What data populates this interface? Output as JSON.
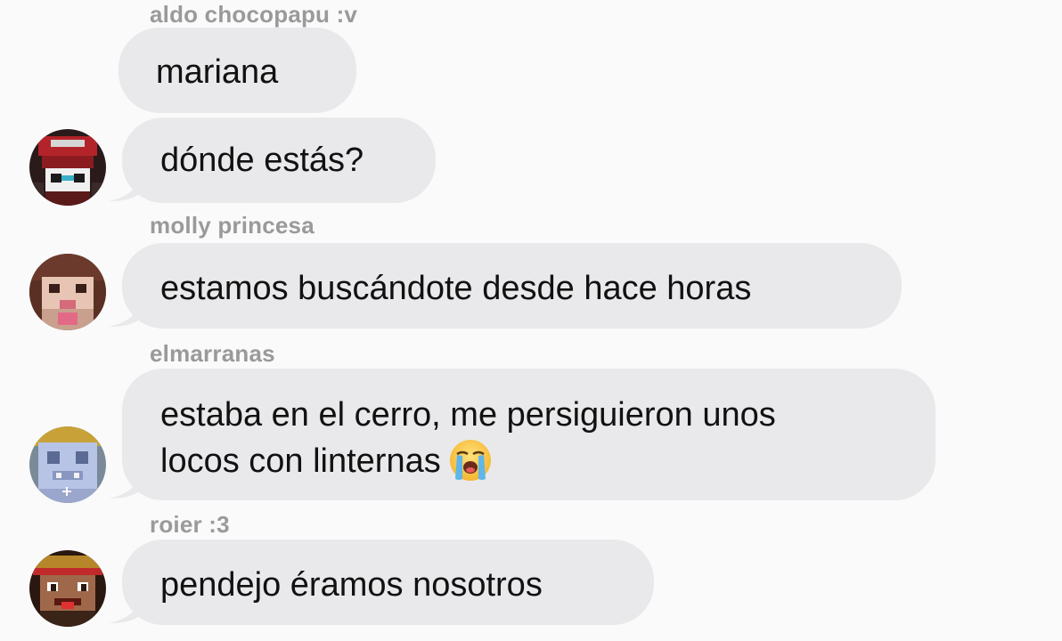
{
  "messages": [
    {
      "sender": "aldo chocopapu :v",
      "text": "mariana"
    },
    {
      "text": "dónde estás?"
    },
    {
      "sender": "molly princesa",
      "text": "estamos buscándote desde hace horas"
    },
    {
      "sender": "elmarranas",
      "line1": "estaba en el cerro, me persiguieron unos",
      "line2": "locos con linternas"
    },
    {
      "sender": "roier :3",
      "text": "pendejo éramos nosotros"
    }
  ],
  "icons": {
    "crying_emoji": "loudly-crying-face-icon"
  },
  "colors": {
    "background": "#fafafa",
    "bubble": "#e9e9eb",
    "sender": "#9a9a9a",
    "text": "#111111"
  }
}
